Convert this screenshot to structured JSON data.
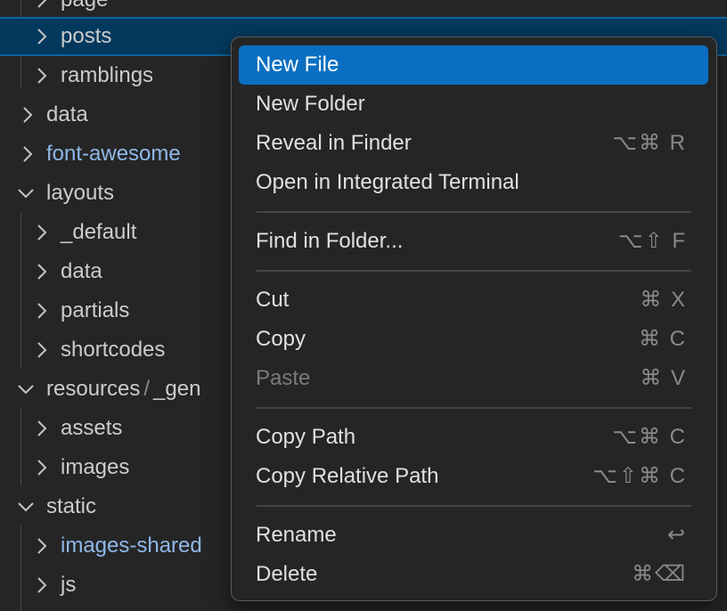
{
  "explorer": {
    "rows": [
      {
        "label": "page",
        "state": "collapsed"
      },
      {
        "label": "posts",
        "state": "collapsed",
        "selected": true
      },
      {
        "label": "ramblings",
        "state": "collapsed"
      },
      {
        "label": "data",
        "state": "collapsed"
      },
      {
        "label": "font-awesome",
        "state": "collapsed",
        "tinted": true
      },
      {
        "label": "layouts",
        "state": "expanded"
      },
      {
        "label": "_default",
        "state": "collapsed"
      },
      {
        "label": "data",
        "state": "collapsed"
      },
      {
        "label": "partials",
        "state": "collapsed"
      },
      {
        "label": "shortcodes",
        "state": "collapsed"
      },
      {
        "label_parts": [
          "resources",
          "/",
          "_gen"
        ],
        "state": "expanded"
      },
      {
        "label": "assets",
        "state": "collapsed"
      },
      {
        "label": "images",
        "state": "collapsed"
      },
      {
        "label": "static",
        "state": "expanded"
      },
      {
        "label": "images-shared",
        "state": "collapsed",
        "tinted": true
      },
      {
        "label": "js",
        "state": "collapsed"
      }
    ]
  },
  "context_menu": {
    "items": [
      {
        "label": "New File",
        "shortcut": "",
        "active": true
      },
      {
        "label": "New Folder",
        "shortcut": ""
      },
      {
        "label": "Reveal in Finder",
        "shortcut": "⌥⌘ R"
      },
      {
        "label": "Open in Integrated Terminal",
        "shortcut": ""
      },
      {
        "label": "Find in Folder...",
        "shortcut": "⌥⇧ F"
      },
      {
        "label": "Cut",
        "shortcut": "⌘ X"
      },
      {
        "label": "Copy",
        "shortcut": "⌘ C"
      },
      {
        "label": "Paste",
        "shortcut": "⌘ V",
        "disabled": true
      },
      {
        "label": "Copy Path",
        "shortcut": "⌥⌘ C"
      },
      {
        "label": "Copy Relative Path",
        "shortcut": "⌥⇧⌘ C"
      },
      {
        "label": "Rename",
        "shortcut": "↩"
      },
      {
        "label": "Delete",
        "shortcut": "⌘⌫"
      }
    ]
  },
  "colors": {
    "background": "#252526",
    "selection": "#04395e",
    "menu_highlight": "#0a6fc2",
    "folder_tint": "#8fb8e8"
  }
}
